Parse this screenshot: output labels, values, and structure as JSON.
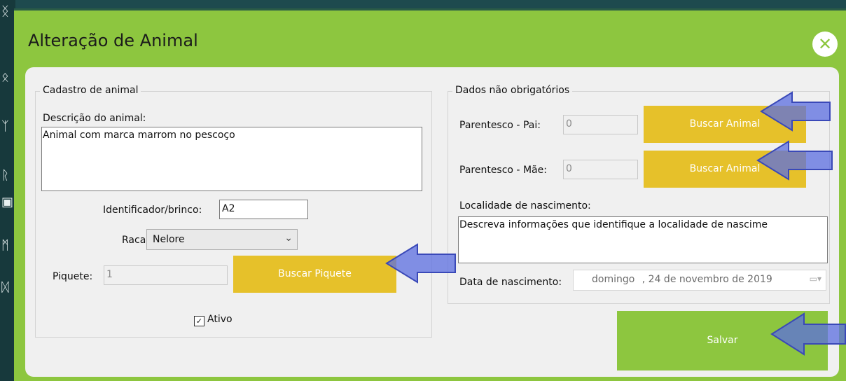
{
  "dialog": {
    "title": "Alteração de Animal",
    "close_icon": "close-icon"
  },
  "left_group": {
    "legend": "Cadastro de animal",
    "description_label": "Descrição do animal:",
    "description_value": "Animal com marca marrom no pescoço",
    "identifier_label": "Identificador/brinco:",
    "identifier_value": "A2",
    "breed_label": "Raca:",
    "breed_value": "Nelore",
    "paddock_label": "Piquete:",
    "paddock_value": "1",
    "search_paddock_button": "Buscar Piquete",
    "active_label": "Ativo",
    "active_checked": true
  },
  "right_group": {
    "legend": "Dados não obrigatórios",
    "father_label": "Parentesco - Pai:",
    "father_value": "0",
    "search_father_button": "Buscar Animal",
    "mother_label": "Parentesco - Mãe:",
    "mother_value": "0",
    "search_mother_button": "Buscar Animal",
    "birthplace_label": "Localidade de nascimento:",
    "birthplace_value": "Descreva informações que identifique a localidade de nascime",
    "birthdate_label": "Data de nascimento:",
    "birthdate_weekday": "domingo",
    "birthdate_rest": ", 24 de novembro de 2019"
  },
  "save_button": "Salvar",
  "colors": {
    "header_green": "#8dc63f",
    "button_yellow": "#e6c12a",
    "arrow_blue": "#5b6ee0"
  }
}
